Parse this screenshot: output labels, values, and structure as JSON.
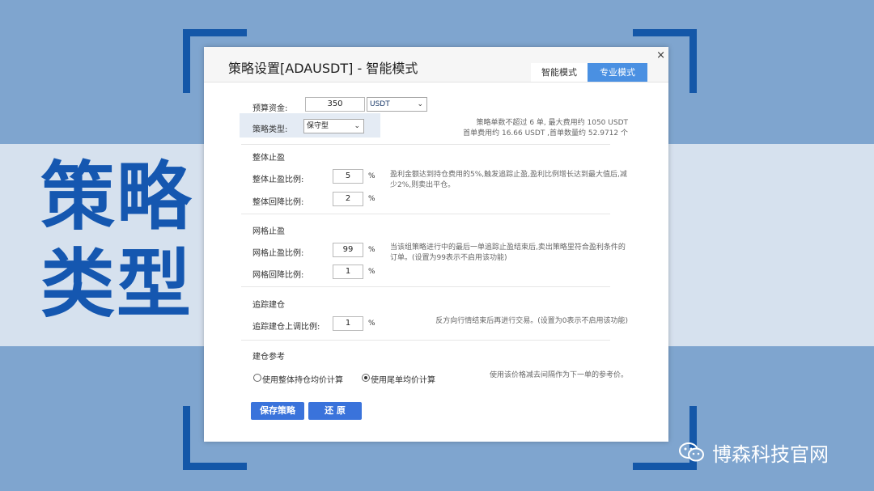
{
  "background_title": [
    "策略",
    "类型"
  ],
  "dialog": {
    "title": "策略设置[ADAUSDT] - 智能模式",
    "close_label": "×",
    "tabs": [
      {
        "label": "智能模式",
        "active": false
      },
      {
        "label": "专业模式",
        "active": true
      }
    ],
    "budget_label": "预算资金:",
    "budget_value": "350",
    "currency": "USDT",
    "strategy_label": "策略类型:",
    "strategy_value": "保守型",
    "strategy_note_line1": "策略单数不超过 6 单, 最大费用约 1050 USDT",
    "strategy_note_line2": "首单费用约 16.66 USDT ,首单数量约 52.9712 个",
    "overall_section": "整体止盈",
    "overall_tp_label": "整体止盈比例:",
    "overall_tp_value": "5",
    "overall_pullback_label": "整体回降比例:",
    "overall_pullback_value": "2",
    "overall_note": "盈利金额达到持仓费用的5%,触发追踪止盈,盈利比例增长达到最大值后,减少2%,则卖出平仓。",
    "grid_section": "网格止盈",
    "grid_tp_label": "网格止盈比例:",
    "grid_tp_value": "99",
    "grid_pullback_label": "网格回降比例:",
    "grid_pullback_value": "1",
    "grid_note": "当该组策略进行中的最后一单追踪止盈结束后,卖出策略里符合盈利条件的订单。(设置为99表示不启用该功能)",
    "track_section": "追踪建仓",
    "track_label": "追踪建仓上调比例:",
    "track_value": "1",
    "track_note": "反方向行情结束后再进行交易。(设置为0表示不启用该功能)",
    "ref_section": "建仓参考",
    "ref_option1": "使用整体持仓均价计算",
    "ref_option2": "使用尾单均价计算",
    "ref_selected": 2,
    "ref_note": "使用该价格减去间隔作为下一单的参考价。",
    "percent": "%",
    "save_button": "保存策略",
    "reset_button": "还 原"
  },
  "brand": {
    "text": "博森科技官网",
    "icon": "wechat-icon"
  },
  "colors": {
    "accent": "#1457a8",
    "button": "#3a73db",
    "tab_active": "#4a90e2",
    "background": "#7fa5cf",
    "band": "#d6e1ee"
  }
}
